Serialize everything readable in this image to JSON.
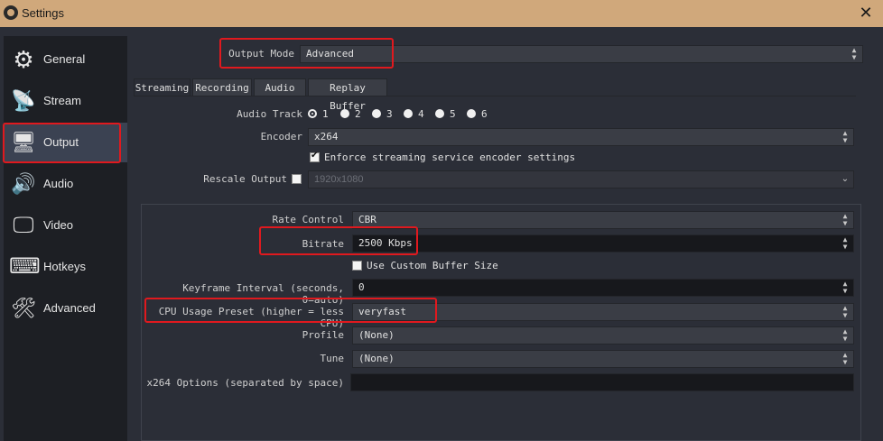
{
  "window": {
    "title": "Settings",
    "close_glyph": "✕",
    "app_icon": "obs-logo-icon"
  },
  "sidebar": {
    "items": [
      {
        "label": "General",
        "icon": "gear-icon",
        "glyph": "⚙"
      },
      {
        "label": "Stream",
        "icon": "antenna-icon",
        "glyph": "📡"
      },
      {
        "label": "Output",
        "icon": "output-monitor-icon",
        "glyph": "🖥"
      },
      {
        "label": "Audio",
        "icon": "speaker-icon",
        "glyph": "🔊"
      },
      {
        "label": "Video",
        "icon": "monitor-icon",
        "glyph": "🖵"
      },
      {
        "label": "Hotkeys",
        "icon": "keyboard-icon",
        "glyph": "⌨"
      },
      {
        "label": "Advanced",
        "icon": "tools-icon",
        "glyph": "🛠"
      }
    ],
    "selected": "Output"
  },
  "output_mode": {
    "label": "Output Mode",
    "value": "Advanced"
  },
  "tabs": [
    "Streaming",
    "Recording",
    "Audio",
    "Replay Buffer"
  ],
  "active_tab": "Streaming",
  "streaming": {
    "audio_track": {
      "label": "Audio Track",
      "options": [
        "1",
        "2",
        "3",
        "4",
        "5",
        "6"
      ],
      "selected": "1"
    },
    "encoder": {
      "label": "Encoder",
      "value": "x264"
    },
    "enforce": {
      "label": "Enforce streaming service encoder settings",
      "checked": true
    },
    "rescale": {
      "label": "Rescale Output",
      "checked": false,
      "value": "1920x1080"
    },
    "rate_control": {
      "label": "Rate Control",
      "value": "CBR"
    },
    "bitrate": {
      "label": "Bitrate",
      "value": "2500 Kbps"
    },
    "custom_buffer": {
      "label": "Use Custom Buffer Size",
      "checked": false
    },
    "keyframe": {
      "label": "Keyframe Interval (seconds, 0=auto)",
      "value": "0"
    },
    "cpu_preset": {
      "label": "CPU Usage Preset (higher = less CPU)",
      "value": "veryfast"
    },
    "profile": {
      "label": "Profile",
      "value": "(None)"
    },
    "tune": {
      "label": "Tune",
      "value": "(None)"
    },
    "x264_options": {
      "label": "x264 Options (separated by space)",
      "value": ""
    }
  },
  "highlight_color": "#e0191e"
}
